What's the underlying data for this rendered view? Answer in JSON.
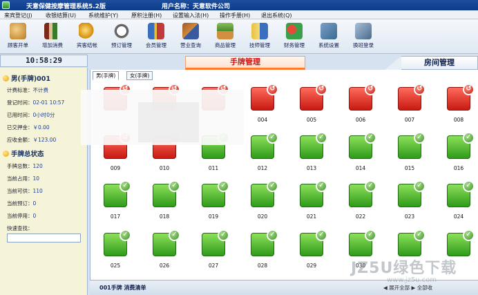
{
  "window": {
    "title": "天意保健按摩管理系统5.2版",
    "company": "用户名称：天意软件公司"
  },
  "menu": [
    "来宾登记(J)",
    "收银结算(U)",
    "系统维护(Y)",
    "原积注册(H)",
    "设置输入法(H)",
    "操作手册(H)",
    "退出系统(Q)"
  ],
  "toolbar": [
    {
      "label": "顾客开单",
      "icon": "key-icon",
      "color": "#c98a2a"
    },
    {
      "label": "增加消费",
      "icon": "bottles-icon",
      "color": "#b44a2a"
    },
    {
      "label": "宾客结帐",
      "icon": "coins-icon",
      "color": "#e3a21a"
    },
    {
      "label": "预订管理",
      "icon": "alarm-clock-icon",
      "color": "#6a6a6a"
    },
    {
      "label": "会员管理",
      "icon": "gift-icon",
      "color": "#3a6fc0"
    },
    {
      "label": "营业查询",
      "icon": "search-books-icon",
      "color": "#8a4a2a"
    },
    {
      "label": "商品管理",
      "icon": "boxes-icon",
      "color": "#5a8a3a"
    },
    {
      "label": "技师管理",
      "icon": "technician-icon",
      "color": "#d0a020"
    },
    {
      "label": "财务管理",
      "icon": "finance-icon",
      "color": "#3a9a4a"
    },
    {
      "label": "系统设置",
      "icon": "settings-icon",
      "color": "#4a7aa0"
    },
    {
      "label": "换班登录",
      "icon": "handshake-icon",
      "color": "#4a6a8a"
    }
  ],
  "clock": "10:58:29",
  "tabs": {
    "hand": "手牌管理",
    "room": "房间管理"
  },
  "subtabs": [
    "男(手牌)",
    "女(手牌)"
  ],
  "left": {
    "head1": "男(手牌)001",
    "rows1": [
      {
        "k": "计费标准：",
        "v": "不计费"
      },
      {
        "k": "登记时间：",
        "v": "02-01 10:57"
      },
      {
        "k": "已用时间：",
        "v": "0小时0分"
      },
      {
        "k": "已交押金：",
        "v": "￥0.00"
      },
      {
        "k": "应收金额：",
        "v": "￥123.00"
      }
    ],
    "head2": "手牌总状态",
    "rows2": [
      {
        "k": "手牌总数：",
        "v": "120"
      },
      {
        "k": "当前占用：",
        "v": "10"
      },
      {
        "k": "当前可供：",
        "v": "110"
      },
      {
        "k": "当前预订：",
        "v": "0"
      },
      {
        "k": "当前停用：",
        "v": "0"
      },
      {
        "k": "快速查找：",
        "v": ""
      }
    ]
  },
  "cards": [
    {
      "num": "",
      "status": "occupied"
    },
    {
      "num": "",
      "status": "occupied"
    },
    {
      "num": "",
      "status": "occupied"
    },
    {
      "num": "004",
      "status": "occupied"
    },
    {
      "num": "005",
      "status": "occupied"
    },
    {
      "num": "006",
      "status": "occupied"
    },
    {
      "num": "007",
      "status": "occupied"
    },
    {
      "num": "008",
      "status": "occupied"
    },
    {
      "num": "009",
      "status": "occupied"
    },
    {
      "num": "010",
      "status": "occupied"
    },
    {
      "num": "011",
      "status": "available"
    },
    {
      "num": "012",
      "status": "available"
    },
    {
      "num": "013",
      "status": "available"
    },
    {
      "num": "014",
      "status": "available"
    },
    {
      "num": "015",
      "status": "available"
    },
    {
      "num": "016",
      "status": "available"
    },
    {
      "num": "017",
      "status": "available"
    },
    {
      "num": "018",
      "status": "available"
    },
    {
      "num": "019",
      "status": "available"
    },
    {
      "num": "020",
      "status": "available"
    },
    {
      "num": "021",
      "status": "available"
    },
    {
      "num": "022",
      "status": "available"
    },
    {
      "num": "023",
      "status": "available"
    },
    {
      "num": "024",
      "status": "available"
    },
    {
      "num": "025",
      "status": "available"
    },
    {
      "num": "026",
      "status": "available"
    },
    {
      "num": "027",
      "status": "available"
    },
    {
      "num": "028",
      "status": "available"
    },
    {
      "num": "029",
      "status": "available"
    },
    {
      "num": "030",
      "status": "available"
    },
    {
      "num": "",
      "status": "available"
    },
    {
      "num": "",
      "status": "available"
    }
  ],
  "bottom": {
    "title": "001手牌  消费清单",
    "nav": "◀ 展开全部    ▶ 全部收"
  },
  "watermark": {
    "main": "JZ5U绿色下载",
    "sub": "www.jz5u.com"
  },
  "colors": {
    "occupied": "#d4221a",
    "available": "#3aa020",
    "accent": "#ff7a2a"
  }
}
